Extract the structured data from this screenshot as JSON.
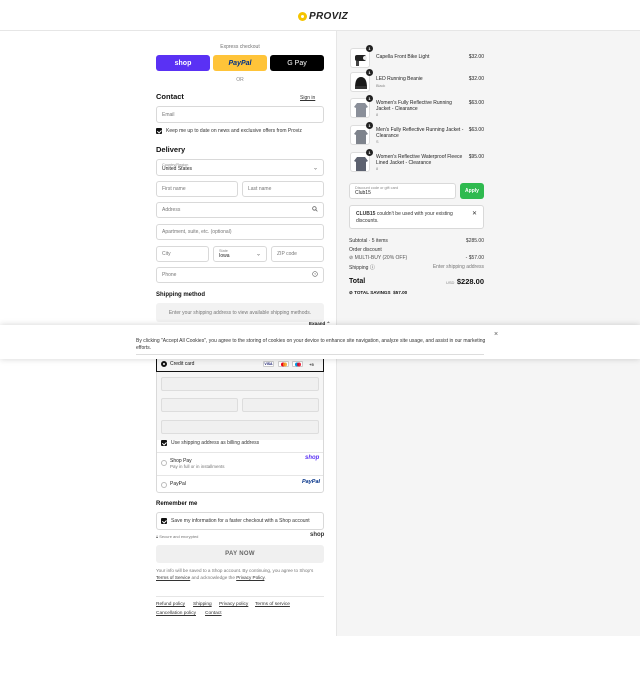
{
  "brand": {
    "name": "PROVIZ",
    "accent": "#f5c400"
  },
  "express": {
    "label": "Express checkout",
    "shop_label": "shop",
    "paypal_label": "PayPal",
    "gpay_label": "G Pay",
    "or_label": "OR"
  },
  "contact": {
    "title": "Contact",
    "signin": "Sign in",
    "email_placeholder": "Email",
    "news_label": "Keep me up to date on news and exclusive offers from Proviz"
  },
  "delivery": {
    "title": "Delivery",
    "country_label": "Country/Region",
    "country_value": "United States",
    "first_name": "First name",
    "last_name": "Last name",
    "address": "Address",
    "apartment": "Apartment, suite, etc. (optional)",
    "city": "City",
    "state_label": "State",
    "state_value": "Iowa",
    "zip": "ZIP code",
    "phone": "Phone"
  },
  "shipping": {
    "title": "Shipping method",
    "placeholder": "Enter your shipping address to view available shipping methods.",
    "expand": "Expand"
  },
  "cookie": {
    "text": "By clicking \"Accept All Cookies\", you agree to the storing of cookies on your device to enhance site navigation, analyze site usage, and assist in our marketing efforts.",
    "close": "×"
  },
  "payment": {
    "credit_card": "Credit card",
    "cards": [
      "VISA",
      "MC",
      "MA",
      "+5"
    ],
    "billing_label": "Use shipping address as billing address",
    "shop_pay": "Shop Pay",
    "shop_pay_sub": "Pay in full or in installments",
    "shop_word": "shop",
    "paypal": "PayPal",
    "paypal_word": "PayPal"
  },
  "remember": {
    "title": "Remember me",
    "label": "Save my information for a faster checkout with a Shop account",
    "secure": "Secure and encrypted",
    "shop_word": "shop"
  },
  "pay_now": "PAY NOW",
  "legal": {
    "prefix": "Your info will be saved to a Shop account. By continuing, you agree to Shop's ",
    "terms": "Terms of Service",
    "middle": " and acknowledge the ",
    "privacy": "Privacy Policy",
    "suffix": "."
  },
  "footer": [
    "Refund policy",
    "Shipping",
    "Privacy policy",
    "Terms of service",
    "Cancellation policy",
    "Contact"
  ],
  "cart": {
    "items": [
      {
        "name": "Capella Front Bike Light",
        "sub": "",
        "qty": "1",
        "price": "$32.00"
      },
      {
        "name": "LED Running Beanie",
        "sub": "Black",
        "qty": "1",
        "price": "$32.00"
      },
      {
        "name": "Women's Fully Reflective Running Jacket - Clearance",
        "sub": "8",
        "qty": "1",
        "price": "$63.00"
      },
      {
        "name": "Men's Fully Reflective Running Jacket - Clearance",
        "sub": "S",
        "qty": "1",
        "price": "$63.00"
      },
      {
        "name": "Women's Reflective Waterproof Fleece Lined Jacket - Clearance",
        "sub": "8",
        "qty": "1",
        "price": "$95.00"
      }
    ],
    "discount_label": "Discount code or gift card",
    "discount_value": "Club15",
    "apply": "Apply",
    "error_code": "CLUB15",
    "error_text": " couldn't be used with your existing discounts.",
    "subtotal_label": "Subtotal · 5 items",
    "subtotal_value": "$285.00",
    "order_discount_label": "Order discount",
    "multibuy_label": "MULTI-BUY (20% OFF)",
    "multibuy_value": "- $57.00",
    "shipping_label": "Shipping",
    "shipping_value": "Enter shipping address",
    "total_label": "Total",
    "currency": "USD",
    "total_value": "$228.00",
    "savings_label": "TOTAL SAVINGS",
    "savings_value": "$57.00"
  }
}
